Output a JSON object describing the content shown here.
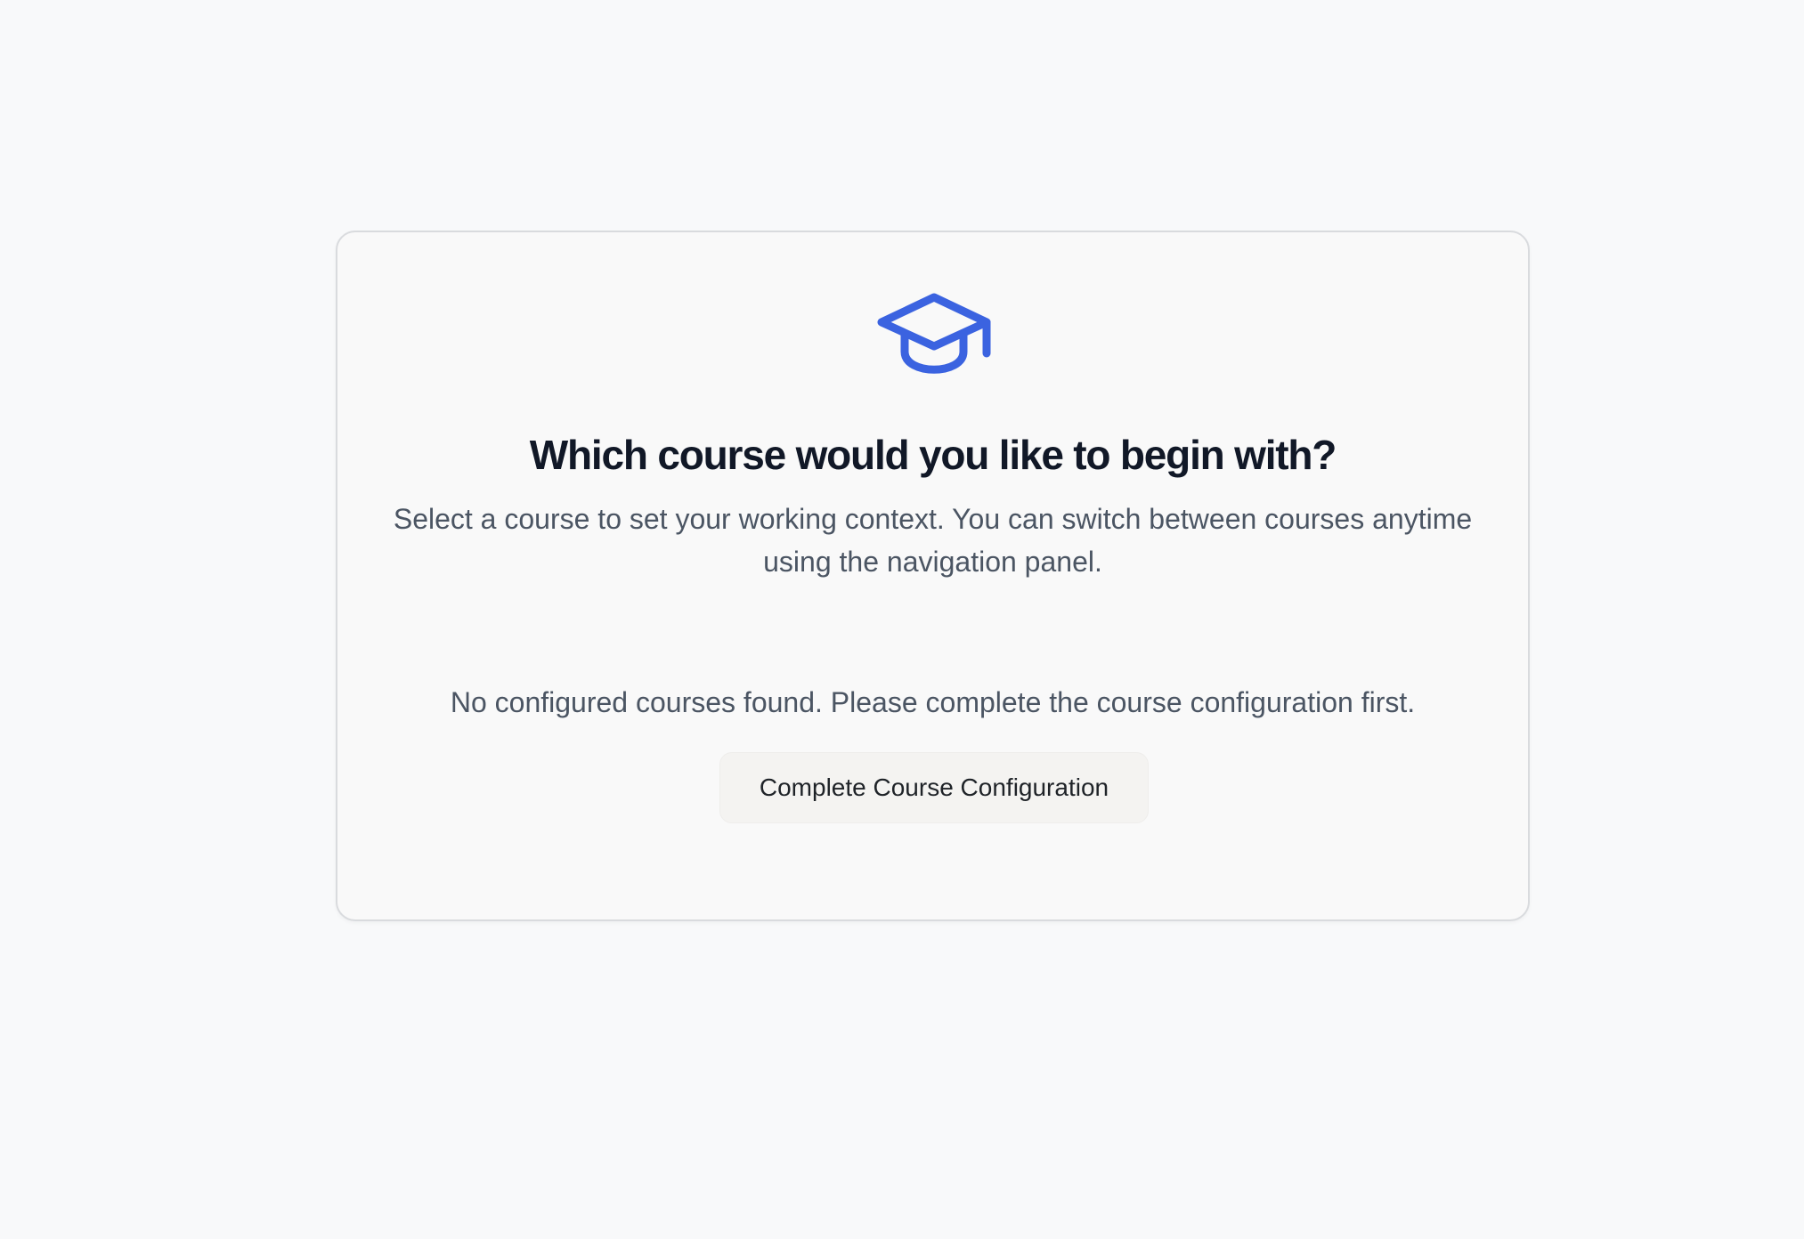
{
  "dialog": {
    "icon": "graduation-cap-icon",
    "icon_color": "#3b63e0",
    "title": "Which course would you like to begin with?",
    "subtitle": "Select a course to set your working context. You can switch between courses anytime using the navigation panel.",
    "empty_message": "No configured courses found. Please complete the course configuration first.",
    "action_label": "Complete Course Configuration"
  }
}
